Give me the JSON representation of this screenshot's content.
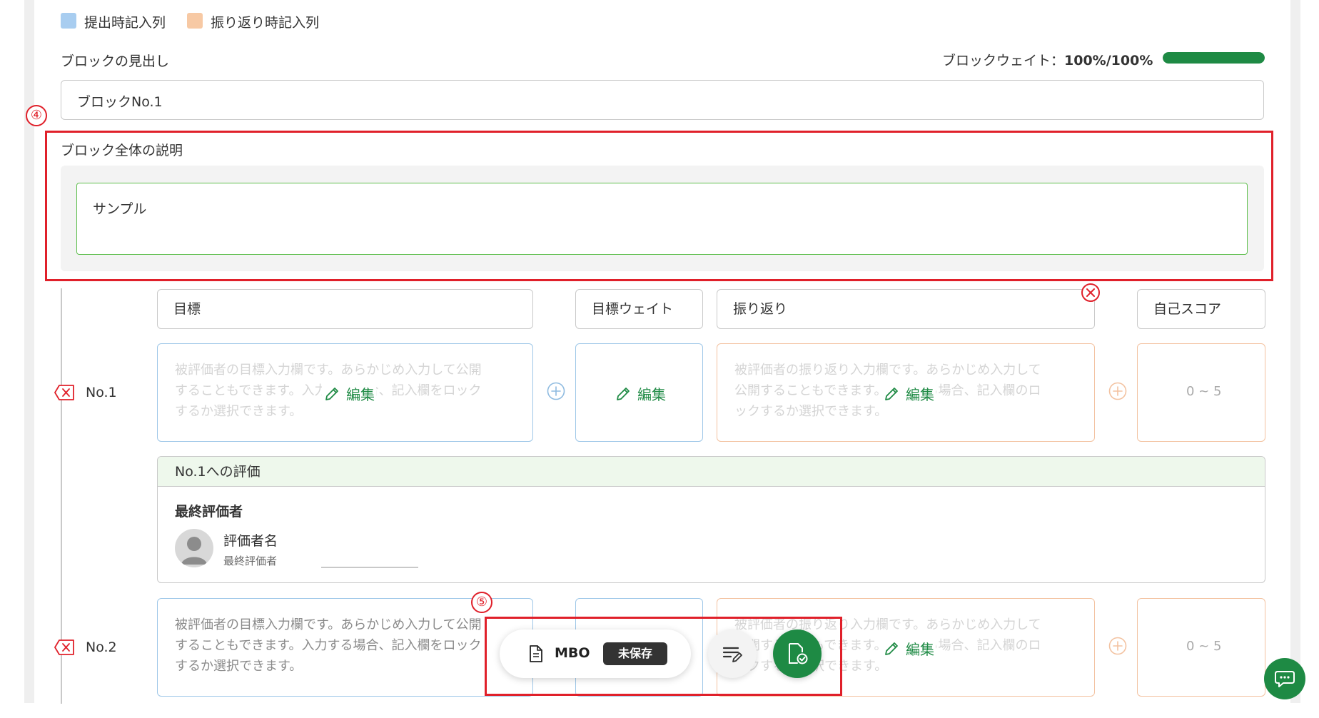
{
  "legend": [
    {
      "label": "提出時記入列",
      "color": "#a8cdf0"
    },
    {
      "label": "振り返り時記入列",
      "color": "#f7c9a4"
    }
  ],
  "block": {
    "heading_label": "ブロックの見出し",
    "heading_value": "ブロックNo.1",
    "weight_label": "ブロックウェイト：",
    "weight_value": "100%/100%",
    "weight_progress": 1.0,
    "description_label": "ブロック全体の説明",
    "description_value": "サンプル"
  },
  "annotations": {
    "four": "④",
    "five": "⑤"
  },
  "columns": {
    "goal": "目標",
    "goal_weight": "目標ウェイト",
    "reflection": "振り返り",
    "self_score": "自己スコア"
  },
  "rows": [
    {
      "label": "No.1",
      "goal_placeholder": [
        "被評価者の目標入力欄です。あらかじめ入力して公開",
        "することもできます。入力する場合、記入欄をロック",
        "するか選択できます。"
      ],
      "reflection_placeholder": [
        "被評価者の振り返り入力欄です。あらかじめ入力して",
        "公開することもできます。入力する場合、記入欄のロ",
        "ックするか選択できます。"
      ],
      "edit_label": "編集",
      "score_range": "0 ~ 5"
    },
    {
      "label": "No.2",
      "goal_placeholder": [
        "被評価者の目標入力欄です。あらかじめ入力して公開",
        "することもできます。入力する場合、記入欄をロック",
        "するか選択できます。"
      ],
      "reflection_placeholder": [
        "被評価者の振り返り入力欄です。あらかじめ入力して",
        "公開することもできます。入力する場合、記入欄のロ",
        "ックするか選択できます。"
      ],
      "edit_label": "編集",
      "score_range": "0 ~ 5"
    }
  ],
  "evaluation": {
    "title": "No.1への評価",
    "role_heading": "最終評価者",
    "evaluator_name": "評価者名",
    "evaluator_role": "最終評価者"
  },
  "toolbar": {
    "doc_label": "MBO",
    "status_badge": "未保存"
  },
  "colors": {
    "accent_green": "#1e8a44",
    "annotation_red": "#e0202a",
    "blue_column": "#9ec7e8",
    "orange_column": "#f3c2a0"
  }
}
